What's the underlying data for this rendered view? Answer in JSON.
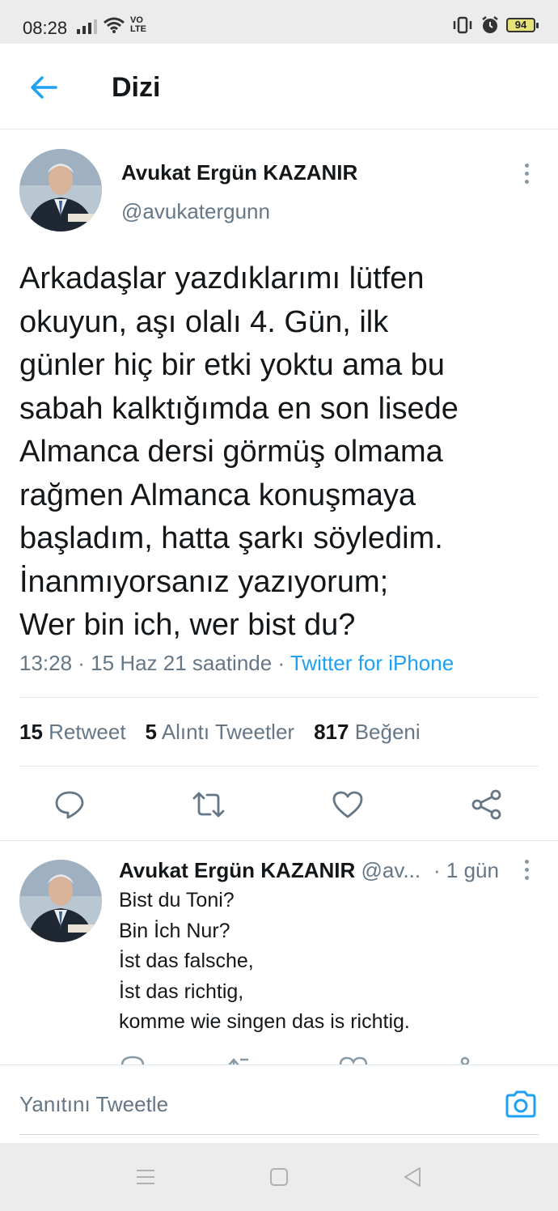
{
  "status_bar": {
    "time": "08:28",
    "network": "VO LTE",
    "battery": "94"
  },
  "header": {
    "title": "Dizi"
  },
  "tweet": {
    "author_name": "Avukat Ergün KAZANIR",
    "author_handle": "@avukatergunn",
    "text_lines": [
      "Arkadaşlar yazdıklarımı lütfen",
      "okuyun, aşı olalı 4. Gün, ilk",
      "günler hiç bir etki yoktu ama bu",
      "sabah kalktığımda en son lisede",
      "Almanca dersi görmüş olmama",
      "rağmen Almanca konuşmaya",
      "başladım, hatta şarkı söyledim.",
      "İnanmıyorsanız yazıyorum;",
      "Wer bin ich, wer bist du?"
    ],
    "timestamp": "13:28 · 15 Haz 21 saatinde · ",
    "source": "Twitter for iPhone",
    "stats": {
      "retweets": "15",
      "retweets_label": "Retweet",
      "quotes": "5",
      "quotes_label": "Alıntı Tweetler",
      "likes": "817",
      "likes_label": "Beğeni"
    }
  },
  "reply": {
    "author_name": "Avukat Ergün KAZANIR",
    "author_handle": "@av...",
    "time": "· 1 gün",
    "text_lines": [
      "Bist du Toni?",
      "Bin İch Nur?",
      "İst das falsche,",
      "İst das richtig,",
      "komme wie singen das is richtig."
    ]
  },
  "compose": {
    "placeholder": "Yanıtını Tweetle"
  },
  "icons": {
    "back": "arrow-left-icon",
    "more": "more-vertical-icon",
    "reply": "comment-icon",
    "retweet": "retweet-icon",
    "like": "heart-icon",
    "share": "share-icon",
    "camera": "camera-icon"
  },
  "colors": {
    "accent": "#1da1f2",
    "secondary_text": "#657786",
    "primary_text": "#14171a"
  }
}
